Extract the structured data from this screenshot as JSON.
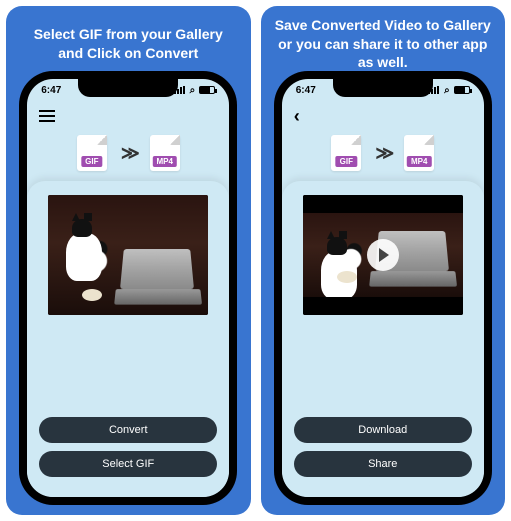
{
  "panels": [
    {
      "caption": "Select GIF from your Gallery and Click on Convert",
      "time": "6:47",
      "nav_style": "burger",
      "hero": {
        "left": "GIF",
        "right": "MP4"
      },
      "media": {
        "bars": false,
        "play": false
      },
      "buttons": [
        {
          "label": "Convert"
        },
        {
          "label": "Select GIF"
        }
      ]
    },
    {
      "caption": "Save Converted Video to Gallery or you can share it to other app as well.",
      "time": "6:47",
      "nav_style": "back",
      "hero": {
        "left": "GIF",
        "right": "MP4"
      },
      "media": {
        "bars": true,
        "play": true
      },
      "buttons": [
        {
          "label": "Download"
        },
        {
          "label": "Share"
        }
      ]
    }
  ]
}
